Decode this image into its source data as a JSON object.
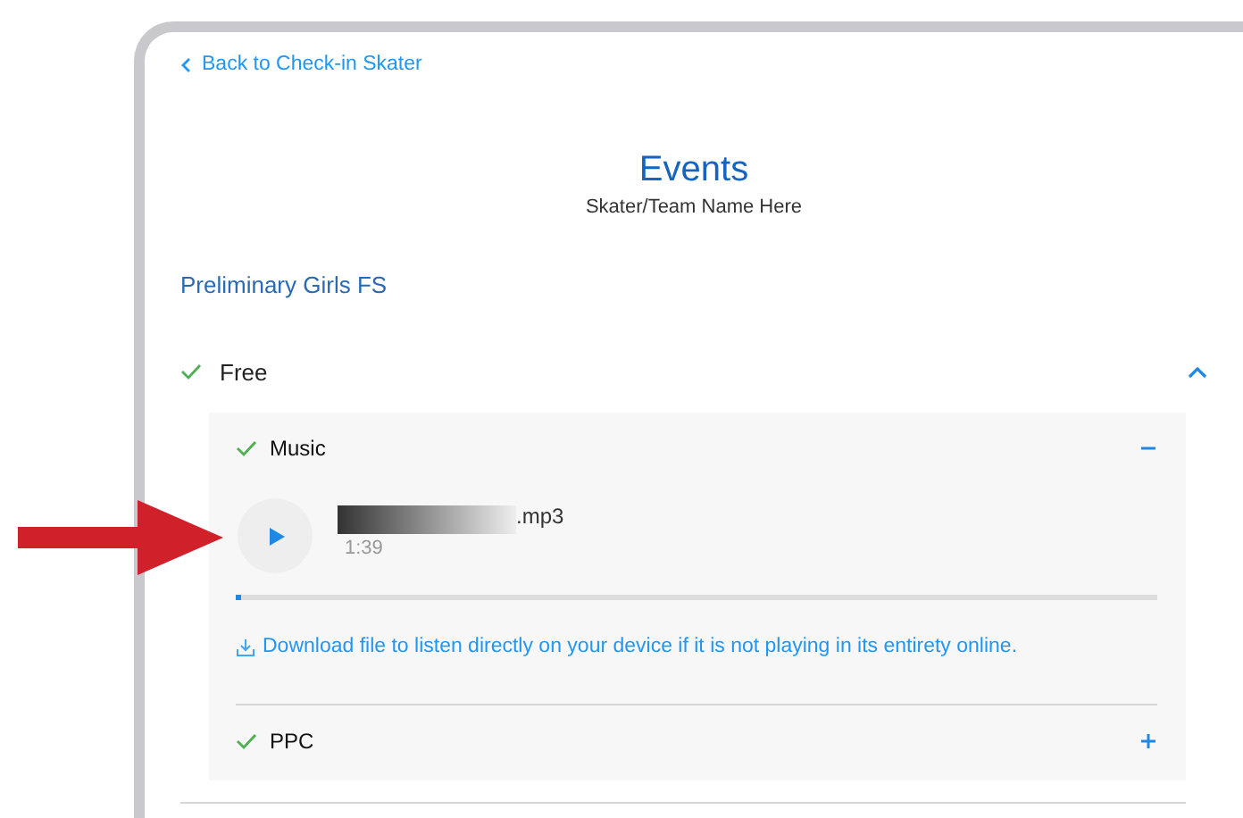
{
  "back_link": {
    "label": "Back to Check-in Skater"
  },
  "header": {
    "title": "Events",
    "subtitle": "Skater/Team Name Here"
  },
  "event": {
    "name": "Preliminary Girls FS",
    "segments": [
      {
        "label": "Free",
        "complete": true,
        "expanded": true,
        "sections": [
          {
            "kind": "music",
            "label": "Music",
            "complete": true,
            "expanded": true,
            "file": {
              "name": ".mp3",
              "duration": "1:39",
              "level": 0.005
            },
            "download_note": "Download file to listen directly on your device if it is not playing in its entirety online."
          },
          {
            "label": "PPC",
            "complete": true,
            "expanded": false
          }
        ]
      }
    ]
  }
}
